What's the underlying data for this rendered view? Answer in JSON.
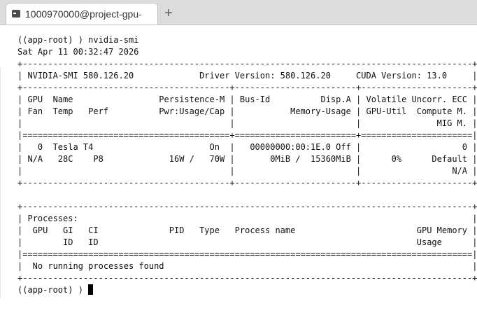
{
  "tab": {
    "title": "1000970000@project-gpu-",
    "new_tab_symbol": "+"
  },
  "terminal": {
    "prompt": "((app-root) )",
    "command": "nvidia-smi",
    "output_lines": [
      "Sat Apr 11 00:32:47 2026",
      "+-----------------------------------------------------------------------------------------+",
      "| NVIDIA-SMI 580.126.20             Driver Version: 580.126.20     CUDA Version: 13.0     |",
      "+-----------------------------------------+------------------------+----------------------+",
      "| GPU  Name                 Persistence-M | Bus-Id          Disp.A | Volatile Uncorr. ECC |",
      "| Fan  Temp   Perf          Pwr:Usage/Cap |           Memory-Usage | GPU-Util  Compute M. |",
      "|                                         |                        |               MIG M. |",
      "|=========================================+========================+======================|",
      "|   0  Tesla T4                       On  |   00000000:00:1E.0 Off |                    0 |",
      "| N/A   28C    P8             16W /   70W |       0MiB /  15360MiB |      0%      Default |",
      "|                                         |                        |                  N/A |",
      "+-----------------------------------------+------------------------+----------------------+",
      "",
      "+-----------------------------------------------------------------------------------------+",
      "| Processes:                                                                              |",
      "|  GPU   GI   CI              PID   Type   Process name                        GPU Memory |",
      "|        ID   ID                                                               Usage      |",
      "|=========================================================================================|",
      "|  No running processes found                                                             |",
      "+-----------------------------------------------------------------------------------------+"
    ],
    "final_prompt": "((app-root) ) "
  }
}
